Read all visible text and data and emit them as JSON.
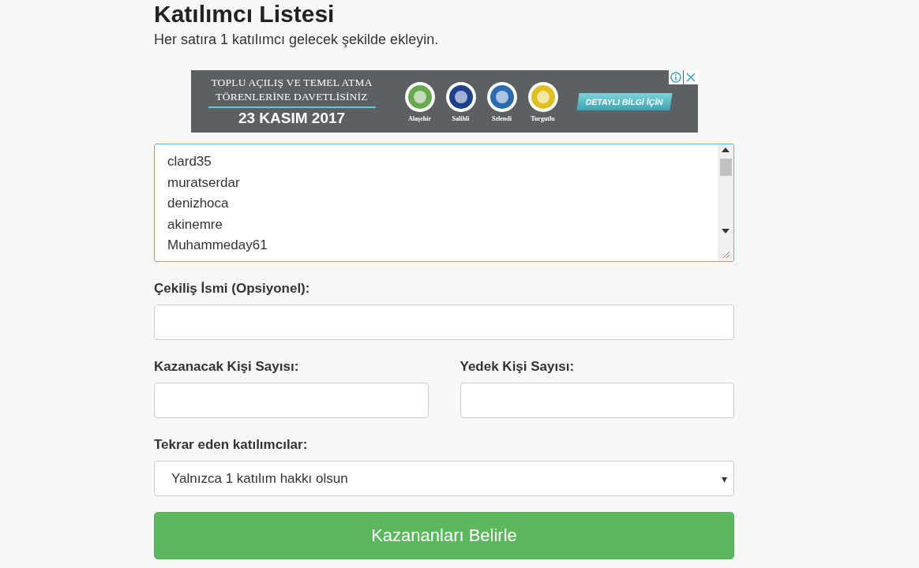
{
  "header": {
    "title": "Katılımcı Listesi",
    "subtitle": "Her satıra 1 katılımcı gelecek şekilde ekleyin."
  },
  "ad": {
    "headline": [
      "TOPLU AÇILIŞ VE TEMEL ATMA",
      "TÖRENLERİNE DAVETLİSİNİZ"
    ],
    "date": "23 KASIM 2017",
    "logos": [
      {
        "label": "Alaşehir",
        "color": "#6aa84f"
      },
      {
        "label": "Salihli",
        "color": "#1f3f8f"
      },
      {
        "label": "Selendi",
        "color": "#2b6cb0"
      },
      {
        "label": "Turgutlu",
        "color": "#e0c020"
      }
    ],
    "cta": "DETAYLI BİLGİ İÇİN"
  },
  "participants": {
    "lines": [
      "clard35",
      "muratserdar",
      "denizhoca",
      "akinemre",
      "Muhammeday61"
    ],
    "focused": true
  },
  "draw_name": {
    "label": "Çekiliş İsmi (Opsiyonel):"
  },
  "counts": [
    {
      "label": "Kazanacak Kişi Sayısı:"
    },
    {
      "label": "Yedek Kişi Sayısı:"
    }
  ],
  "repeats": {
    "label": "Tekrar eden katılımcılar:",
    "value": "Yalnızca 1 katılım hakkı olsun",
    "arrow": "▾"
  },
  "submit": {
    "label": "Kazananları Belirle"
  }
}
